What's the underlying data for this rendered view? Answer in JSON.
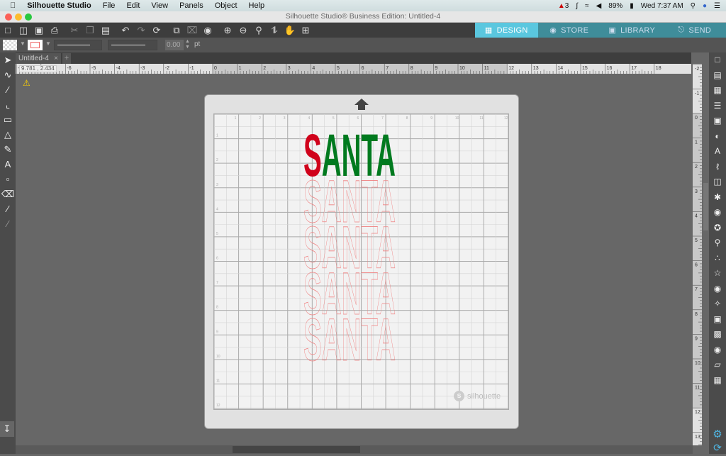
{
  "menubar": {
    "app": "Silhouette Studio",
    "items": [
      "File",
      "Edit",
      "View",
      "Panels",
      "Object",
      "Help"
    ],
    "status": {
      "notif": "3",
      "battery": "89%",
      "clock": "Wed 7:37 AM"
    }
  },
  "window": {
    "title": "Silhouette Studio® Business Edition: Untitled-4"
  },
  "main_tabs": [
    {
      "label": "DESIGN",
      "icon": "grid-icon"
    },
    {
      "label": "STORE",
      "icon": "store-icon"
    },
    {
      "label": "LIBRARY",
      "icon": "library-icon"
    },
    {
      "label": "SEND",
      "icon": "send-icon"
    }
  ],
  "toolbar2": {
    "line_width": "0.00",
    "unit": "pt"
  },
  "doc_tab": {
    "label": "Untitled-4",
    "close": "×",
    "add": "+"
  },
  "coords": "9.781 , 2.434",
  "ruler": {
    "h_min": -8,
    "h_max": 18,
    "v_max": 12
  },
  "design": {
    "first_letter": "S",
    "rest": "ANTA",
    "outline_copies": 4,
    "colors": {
      "first": "#d0021b",
      "rest": "#007a1f",
      "outline": "#f08080"
    }
  },
  "mat": {
    "brand": "silhouette",
    "size_in": 12
  },
  "colors": {
    "accent": "#5ac7df",
    "tab": "#3f8d9a"
  }
}
